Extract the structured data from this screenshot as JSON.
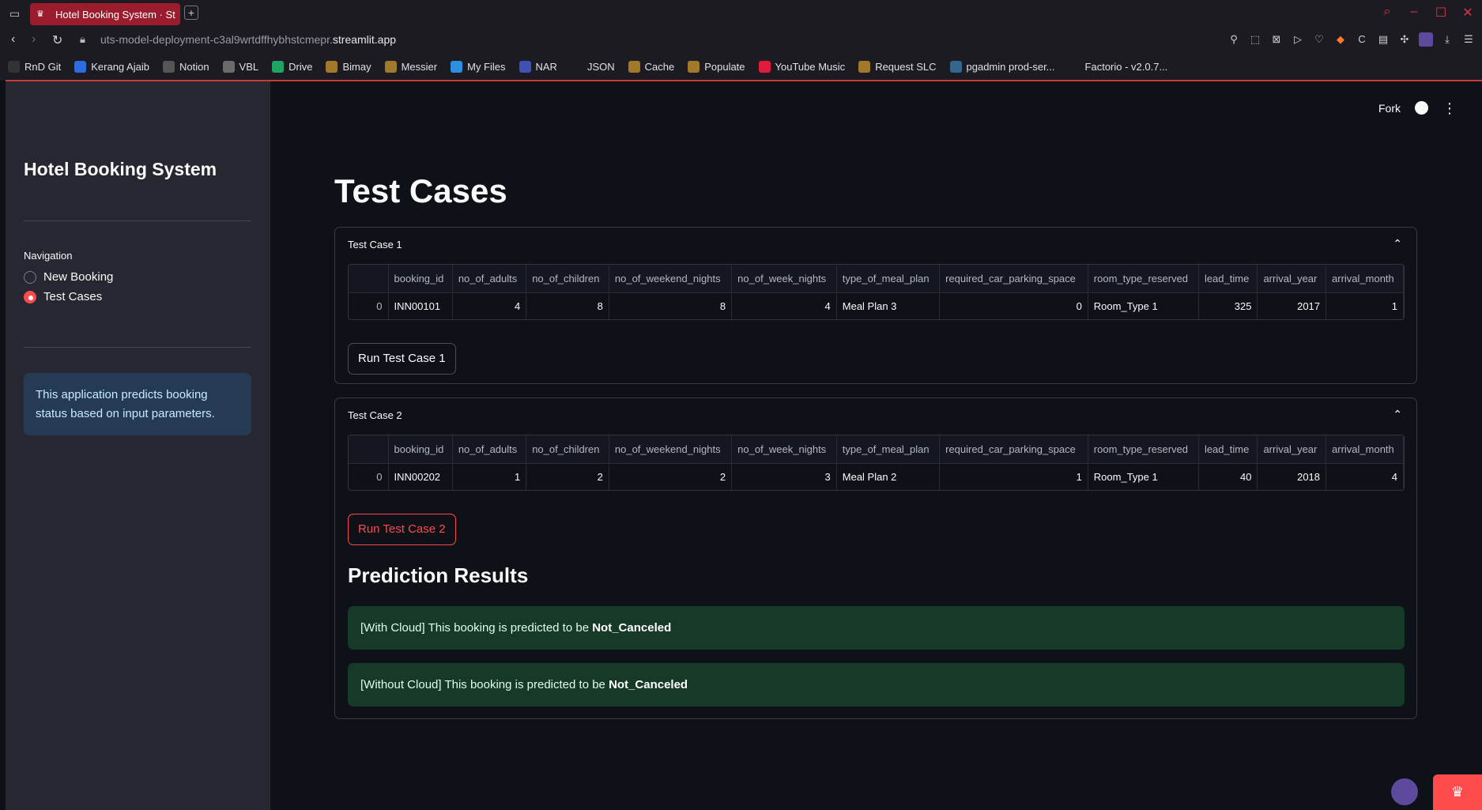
{
  "browser": {
    "tab_title": "Hotel Booking System · St",
    "url_path": "uts-model-deployment-c3al9wrtdffhybhstcmepr.",
    "url_host": "streamlit.app",
    "bookmarks": [
      {
        "label": "RnD Git",
        "icon": "github-icon",
        "color": "#333333"
      },
      {
        "label": "Kerang Ajaib",
        "icon": "app-icon",
        "color": "#2d6cdf"
      },
      {
        "label": "Notion",
        "icon": "home-icon",
        "color": "#555555"
      },
      {
        "label": "VBL",
        "icon": "app-icon",
        "color": "#6b6b6b"
      },
      {
        "label": "Drive",
        "icon": "drive-icon",
        "color": "#1fa463"
      },
      {
        "label": "Bimay",
        "icon": "eye-icon",
        "color": "#a07a2a"
      },
      {
        "label": "Messier",
        "icon": "eye-icon",
        "color": "#a07a2a"
      },
      {
        "label": "My Files",
        "icon": "cloud-icon",
        "color": "#2d8fe0"
      },
      {
        "label": "NAR",
        "icon": "app-icon",
        "color": "#3f51b5"
      },
      {
        "label": "JSON",
        "icon": "json-icon",
        "color": "#1c1b22"
      },
      {
        "label": "Cache",
        "icon": "eye-icon",
        "color": "#a07a2a"
      },
      {
        "label": "Populate",
        "icon": "eye-icon",
        "color": "#a07a2a"
      },
      {
        "label": "YouTube Music",
        "icon": "youtube-music-icon",
        "color": "#e21b3c"
      },
      {
        "label": "Request SLC",
        "icon": "eye-icon",
        "color": "#a07a2a"
      },
      {
        "label": "pgadmin prod-ser...",
        "icon": "pgadmin-icon",
        "color": "#336791"
      },
      {
        "label": "Factorio - v2.0.7...",
        "icon": "page-icon",
        "color": "#1c1b22"
      }
    ]
  },
  "sidebar": {
    "title": "Hotel Booking System",
    "nav_label": "Navigation",
    "options": [
      {
        "label": "New Booking",
        "selected": false
      },
      {
        "label": "Test Cases",
        "selected": true
      }
    ],
    "info": "This application predicts booking status based on input parameters."
  },
  "header": {
    "fork_label": "Fork"
  },
  "main": {
    "title": "Test Cases",
    "columns": [
      "booking_id",
      "no_of_adults",
      "no_of_children",
      "no_of_weekend_nights",
      "no_of_week_nights",
      "type_of_meal_plan",
      "required_car_parking_space",
      "room_type_reserved",
      "lead_time",
      "arrival_year",
      "arrival_month"
    ],
    "test_cases": [
      {
        "header": "Test Case 1",
        "row": {
          "index": "0",
          "cells": [
            "INN00101",
            "4",
            "8",
            "8",
            "4",
            "Meal Plan 3",
            "0",
            "Room_Type 1",
            "325",
            "2017",
            "1"
          ]
        },
        "button": "Run Test Case 1"
      },
      {
        "header": "Test Case 2",
        "row": {
          "index": "0",
          "cells": [
            "INN00202",
            "1",
            "2",
            "2",
            "3",
            "Meal Plan 2",
            "1",
            "Room_Type 1",
            "40",
            "2018",
            "4"
          ]
        },
        "button": "Run Test Case 2"
      }
    ],
    "prediction_title": "Prediction Results",
    "results": [
      {
        "prefix": "[With Cloud] This booking is predicted to be ",
        "value": "Not_Canceled"
      },
      {
        "prefix": "[Without Cloud] This booking is predicted to be ",
        "value": "Not_Canceled"
      }
    ]
  }
}
